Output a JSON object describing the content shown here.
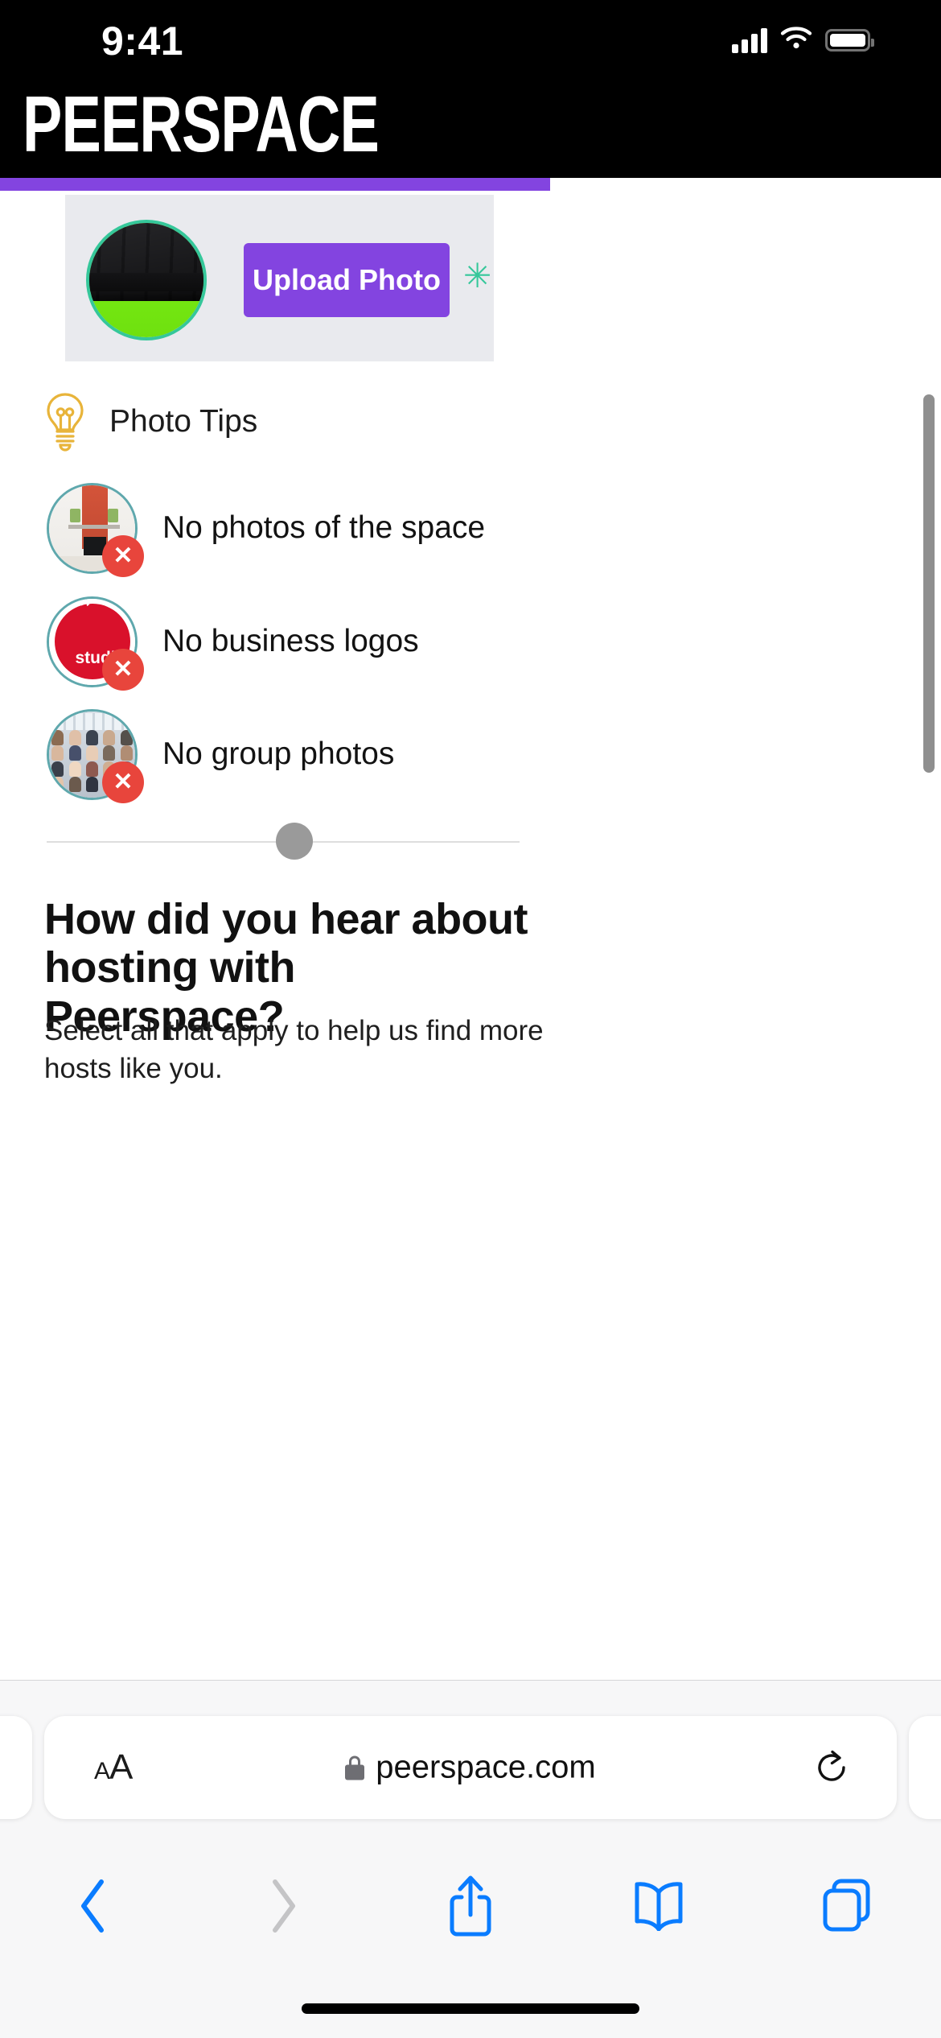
{
  "status_bar": {
    "time": "9:41",
    "signal_icon": "cellular-signal-icon",
    "wifi_icon": "wifi-icon",
    "battery_icon": "battery-icon"
  },
  "site_header": {
    "logo_text": "PEERSPACE",
    "progress_color": "#8344E0",
    "background_color": "#000000"
  },
  "upload_section": {
    "avatar_alt": "keyboard-photo-thumbnail",
    "button_label": "Upload Photo",
    "button_color": "#8344E0",
    "required_marker": "✳",
    "required_marker_color": "#35c79a",
    "panel_color": "#e9eaee"
  },
  "photo_tips": {
    "icon": "lightbulb-icon",
    "icon_color": "#E8B43A",
    "title": "Photo Tips",
    "items": [
      {
        "label": "No photos of the space",
        "badge": "✕",
        "thumb": "interior-fireplace-photo"
      },
      {
        "label": "No business logos",
        "badge": "✕",
        "thumb": "sintak-studio-logo"
      },
      {
        "label": "No group photos",
        "badge": "✕",
        "thumb": "group-team-photo"
      }
    ],
    "badge_color": "#e8453c",
    "ring_color": "#5fa8ad"
  },
  "question_section": {
    "heading": "How did you hear about hosting with Peerspace?",
    "subtext": "Select all that apply to help us find more hosts like you."
  },
  "browser": {
    "text_size_label_small": "A",
    "text_size_label_large": "A",
    "lock_icon": "lock-icon",
    "url": "peerspace.com",
    "reload_icon": "reload-icon",
    "toolbar": [
      {
        "name": "back",
        "icon": "chevron-left-icon",
        "enabled": true
      },
      {
        "name": "forward",
        "icon": "chevron-right-icon",
        "enabled": false
      },
      {
        "name": "share",
        "icon": "share-icon",
        "enabled": true
      },
      {
        "name": "bookmarks",
        "icon": "book-icon",
        "enabled": true
      },
      {
        "name": "tabs",
        "icon": "tabs-icon",
        "enabled": true
      }
    ],
    "accent_color": "#0a7cff",
    "disabled_color": "#c4c4c6"
  }
}
